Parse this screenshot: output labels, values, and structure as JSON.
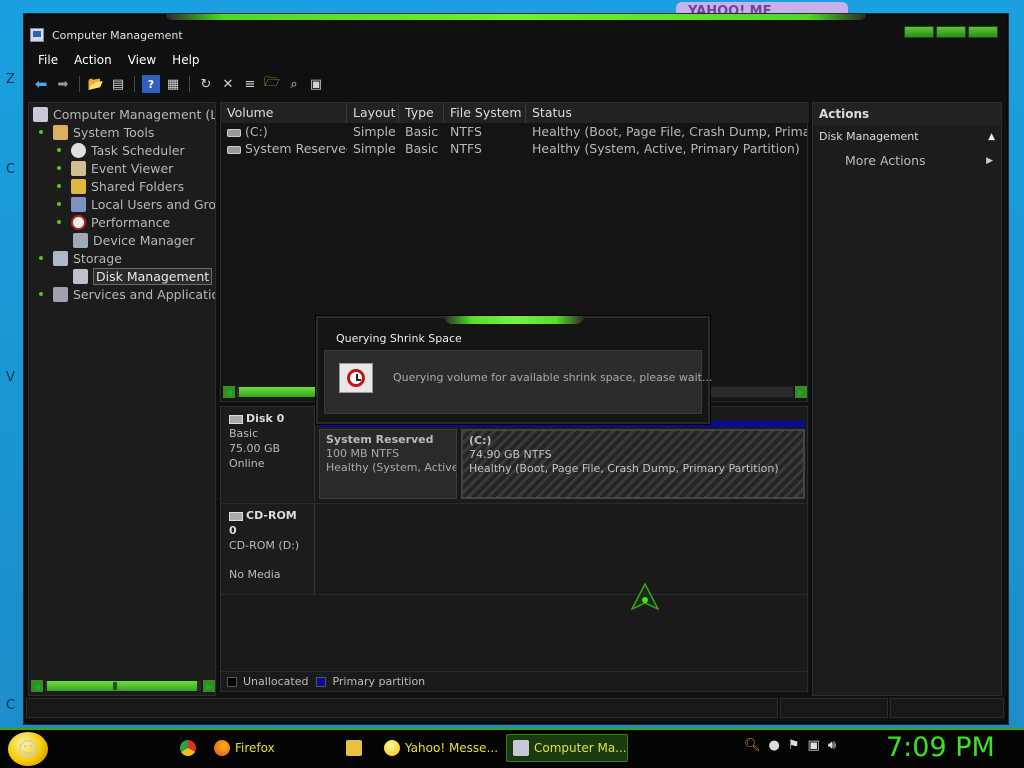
{
  "window": {
    "title": "Computer Management"
  },
  "menu": [
    "File",
    "Action",
    "View",
    "Help"
  ],
  "toolbar_icons": [
    "back-icon",
    "forward-icon",
    "up-folder-icon",
    "show-hide-tree-icon",
    "help-icon",
    "properties-icon",
    "refresh-icon",
    "delete-icon",
    "rescan-icon",
    "open-folder-icon",
    "search-icon",
    "disk-settings-icon"
  ],
  "tree": {
    "root": "Computer Management (Loc",
    "system_tools": "System Tools",
    "task_scheduler": "Task Scheduler",
    "event_viewer": "Event Viewer",
    "shared_folders": "Shared Folders",
    "local_users": "Local Users and Grou",
    "performance": "Performance",
    "device_manager": "Device Manager",
    "storage": "Storage",
    "disk_management": "Disk Management",
    "services": "Services and Applications"
  },
  "volumes": {
    "headers": [
      "Volume",
      "Layout",
      "Type",
      "File System",
      "Status"
    ],
    "rows": [
      {
        "volume": "(C:)",
        "layout": "Simple",
        "type": "Basic",
        "fs": "NTFS",
        "status": "Healthy (Boot, Page File, Crash Dump, Primary"
      },
      {
        "volume": "System Reserved",
        "layout": "Simple",
        "type": "Basic",
        "fs": "NTFS",
        "status": "Healthy (System, Active, Primary Partition)"
      }
    ]
  },
  "disks": {
    "disk0": {
      "name": "Disk 0",
      "type": "Basic",
      "size": "75.00 GB",
      "state": "Online"
    },
    "sys_part": {
      "name": "System Reserved",
      "size": "100 MB NTFS",
      "status": "Healthy (System, Active, P"
    },
    "c_part": {
      "name": "(C:)",
      "size": "74.90 GB NTFS",
      "status": "Healthy (Boot, Page File, Crash Dump, Primary Partition)"
    },
    "cdrom": {
      "name": "CD-ROM 0",
      "drive": "CD-ROM (D:)",
      "media": "No Media"
    }
  },
  "legend": {
    "unallocated": "Unallocated",
    "primary": "Primary partition"
  },
  "colors": {
    "unallocated": "#000000",
    "primary": "#0a0a9a",
    "accent": "#4ec820",
    "clock": "#3fe020"
  },
  "actions": {
    "header": "Actions",
    "section": "Disk Management",
    "more": "More Actions"
  },
  "dialog": {
    "title": "Querying Shrink Space",
    "message": "Querying volume for available shrink space, please wait..."
  },
  "taskbar": {
    "firefox": "Firefox",
    "yahoo": "Yahoo! Messe...",
    "compmgmt": "Computer Ma...",
    "time": "7:09 PM"
  }
}
